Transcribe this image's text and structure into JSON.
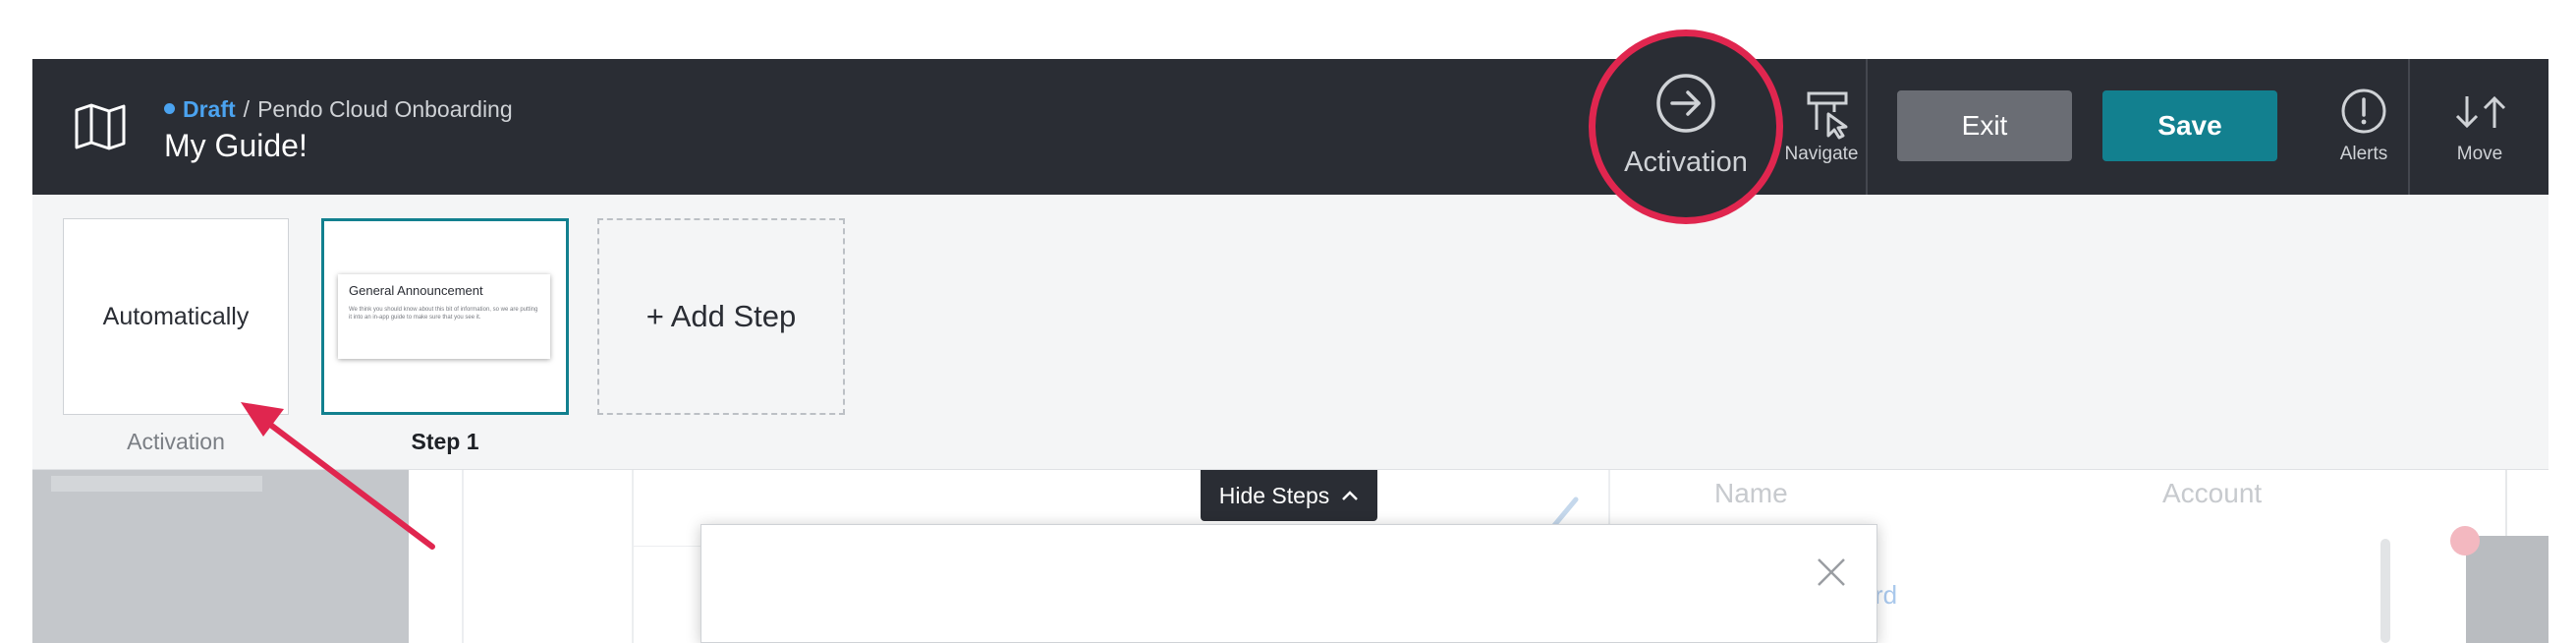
{
  "header": {
    "status": "Draft",
    "separator": "/",
    "app_name": "Pendo Cloud Onboarding",
    "guide_name": "My Guide!",
    "navigate_label": "Navigate",
    "activation_label": "Activation",
    "exit_label": "Exit",
    "save_label": "Save",
    "alerts_label": "Alerts",
    "move_label": "Move"
  },
  "steps": {
    "activation_card_text": "Automatically",
    "activation_label": "Activation",
    "step1_preview_title": "General Announcement",
    "step1_preview_body": "We think you should know about this bit of information, so we are putting it into an in-app guide to make sure that you see it.",
    "step1_label": "Step 1",
    "add_step_label": "+ Add Step",
    "hide_steps_label": "Hide Steps"
  },
  "background": {
    "col_name": "Name",
    "col_account": "Account",
    "partial_link": "rd"
  },
  "colors": {
    "topbar": "#2a2d34",
    "accent_teal": "#12808f",
    "draft_blue": "#4ba3f0",
    "annotation_red": "#e0264f"
  }
}
